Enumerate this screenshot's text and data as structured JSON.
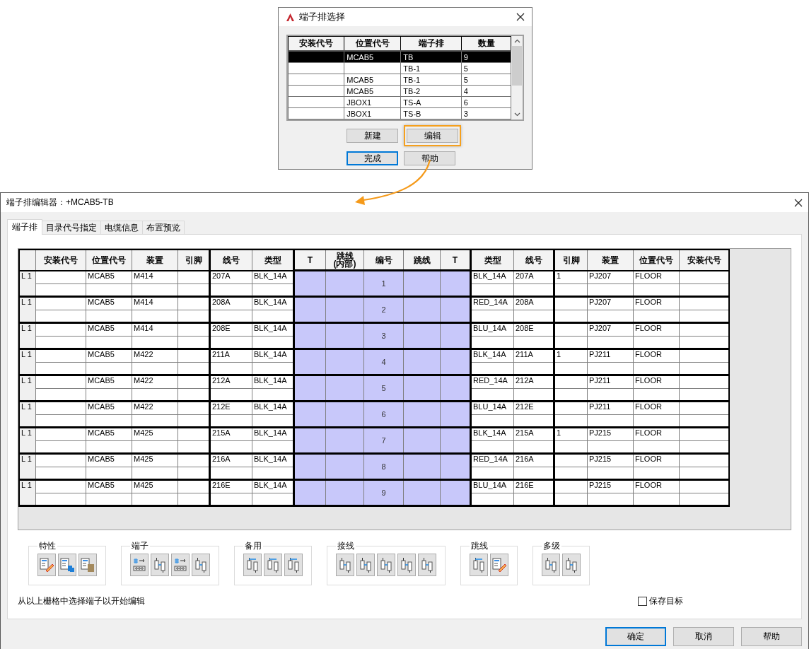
{
  "selector_dialog": {
    "title": "端子排选择",
    "columns": [
      "安装代号",
      "位置代号",
      "端子排",
      "数量"
    ],
    "rows": [
      {
        "location": "MCAB5",
        "strip": "TB",
        "count": "9",
        "selected": true
      },
      {
        "strip": "TB-1",
        "count": "5",
        "selected": false
      },
      {
        "location": "MCAB5",
        "strip": "TB-1",
        "count": "5",
        "selected": false
      },
      {
        "location": "MCAB5",
        "strip": "TB-2",
        "count": "4",
        "selected": false
      },
      {
        "location": "JBOX1",
        "strip": "TS-A",
        "count": "6",
        "selected": false
      },
      {
        "location": "JBOX1",
        "strip": "TS-B",
        "count": "3",
        "selected": false
      }
    ],
    "buttons": [
      {
        "label": "新建",
        "default": false,
        "highlighted": false
      },
      {
        "label": "编辑",
        "default": false,
        "highlighted": true
      },
      {
        "label": "完成",
        "default": true,
        "highlighted": false
      },
      {
        "label": "帮助",
        "default": false,
        "highlighted": false
      }
    ]
  },
  "editor": {
    "title": "端子排编辑器：+MCAB5-TB",
    "tabs": [
      {
        "label": "端子排",
        "selected": true
      },
      {
        "label": "目录代号指定",
        "selected": false
      },
      {
        "label": "电缆信息",
        "selected": false
      },
      {
        "label": "布置预览",
        "selected": false
      }
    ],
    "table": {
      "columns": [
        "安装代号",
        "位置代号",
        "装置",
        "引脚",
        "线号",
        "类型",
        "T",
        "跳线\n(内部)",
        "编号",
        "跳线",
        "T",
        "类型",
        "线号",
        "引脚",
        "装置",
        "位置代号",
        "安装代号"
      ],
      "rows": [
        {
          "level": "L 1",
          "l_location": "MCAB5",
          "l_device": "M414",
          "l_wire": "207A",
          "l_type": "BLK_14A",
          "number": "1",
          "r_type": "BLK_14A",
          "r_wire": "207A",
          "r_pin": "1",
          "r_device": "PJ207",
          "r_location": "FLOOR"
        },
        {
          "level": "L 1",
          "l_location": "MCAB5",
          "l_device": "M414",
          "l_wire": "208A",
          "l_type": "BLK_14A",
          "number": "2",
          "r_type": "RED_14A",
          "r_wire": "208A",
          "r_device": "PJ207",
          "r_location": "FLOOR"
        },
        {
          "level": "L 1",
          "l_location": "MCAB5",
          "l_device": "M414",
          "l_wire": "208E",
          "l_type": "BLK_14A",
          "number": "3",
          "r_type": "BLU_14A",
          "r_wire": "208E",
          "r_device": "PJ207",
          "r_location": "FLOOR"
        },
        {
          "level": "L 1",
          "l_location": "MCAB5",
          "l_device": "M422",
          "l_wire": "211A",
          "l_type": "BLK_14A",
          "number": "4",
          "r_type": "BLK_14A",
          "r_wire": "211A",
          "r_pin": "1",
          "r_device": "PJ211",
          "r_location": "FLOOR"
        },
        {
          "level": "L 1",
          "l_location": "MCAB5",
          "l_device": "M422",
          "l_wire": "212A",
          "l_type": "BLK_14A",
          "number": "5",
          "r_type": "RED_14A",
          "r_wire": "212A",
          "r_device": "PJ211",
          "r_location": "FLOOR"
        },
        {
          "level": "L 1",
          "l_location": "MCAB5",
          "l_device": "M422",
          "l_wire": "212E",
          "l_type": "BLK_14A",
          "number": "6",
          "r_type": "BLU_14A",
          "r_wire": "212E",
          "r_device": "PJ211",
          "r_location": "FLOOR"
        },
        {
          "level": "L 1",
          "l_location": "MCAB5",
          "l_device": "M425",
          "l_wire": "215A",
          "l_type": "BLK_14A",
          "number": "7",
          "r_type": "BLK_14A",
          "r_wire": "215A",
          "r_pin": "1",
          "r_device": "PJ215",
          "r_location": "FLOOR"
        },
        {
          "level": "L 1",
          "l_location": "MCAB5",
          "l_device": "M425",
          "l_wire": "216A",
          "l_type": "BLK_14A",
          "number": "8",
          "r_type": "RED_14A",
          "r_wire": "216A",
          "r_device": "PJ215",
          "r_location": "FLOOR"
        },
        {
          "level": "L 1",
          "l_location": "MCAB5",
          "l_device": "M425",
          "l_wire": "216E",
          "l_type": "BLK_14A",
          "number": "9",
          "r_type": "BLU_14A",
          "r_wire": "216E",
          "r_device": "PJ215",
          "r_location": "FLOOR"
        }
      ]
    },
    "tool_groups": [
      {
        "label": "特性",
        "tools": [
          {
            "kind": "edit"
          },
          {
            "kind": "copy"
          },
          {
            "kind": "paste"
          }
        ]
      },
      {
        "label": "端子",
        "tools": [
          {
            "kind": "renumber"
          },
          {
            "kind": "move"
          },
          {
            "kind": "insert"
          },
          {
            "kind": "move"
          }
        ]
      },
      {
        "label": "备用",
        "tools": [
          {
            "kind": "spare-down"
          },
          {
            "kind": "spare-bar"
          },
          {
            "kind": "spare-up"
          }
        ]
      },
      {
        "label": "接线",
        "tools": [
          {
            "kind": "wire"
          },
          {
            "kind": "wire-up"
          },
          {
            "kind": "wire-side"
          },
          {
            "kind": "wire"
          },
          {
            "kind": "wire-copy"
          }
        ]
      },
      {
        "label": "跳线",
        "tools": [
          {
            "kind": "jumper"
          },
          {
            "kind": "jumper-edit"
          }
        ]
      },
      {
        "label": "多级",
        "tools": [
          {
            "kind": "wire"
          },
          {
            "kind": "wire-back"
          }
        ]
      }
    ],
    "status": "从以上栅格中选择端子以开始编辑",
    "save_target": {
      "label": "保存目标",
      "checked": false
    },
    "buttons": [
      {
        "label": "确定",
        "default": true
      },
      {
        "label": "取消",
        "default": false
      },
      {
        "label": "帮助",
        "default": false
      }
    ]
  }
}
